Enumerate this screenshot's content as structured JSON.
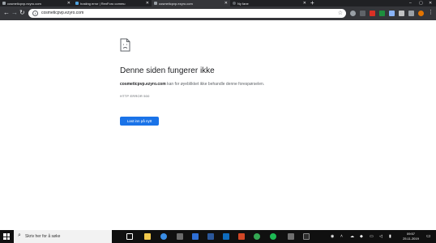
{
  "tabs": [
    {
      "title": "cosmeticpvp.ezyro.com",
      "fav_color": "#9aa0a6",
      "active": false
    },
    {
      "title": "hosting error | RenForo commu",
      "fav_color": "#4fa3e0",
      "active": false
    },
    {
      "title": "cosmeticpvp.ezyro.com",
      "fav_color": "#9aa0a6",
      "active": true
    },
    {
      "title": "Ny fane",
      "fav_color": "#5f6368",
      "active": false
    }
  ],
  "new_tab_label": "+",
  "address": {
    "url": "cosmeticpvp.ezyro.com"
  },
  "error": {
    "title": "Denne siden fungerer ikke",
    "host": "cosmeticpvp.ezyro.com",
    "message": " kan for øyeblikket ikke behandle denne forespørselen.",
    "code": "HTTP ERROR 500",
    "reload_label": "Last inn på nytt"
  },
  "taskbar": {
    "search_placeholder": "Skriv her for å søke",
    "time": "09:57",
    "date": "25.11.2019",
    "icons": [
      {
        "name": "task-view-icon",
        "color": "#ffffff"
      },
      {
        "name": "file-explorer-icon",
        "color": "#f2c94c"
      },
      {
        "name": "edge-icon",
        "color": "#3a8ee6"
      },
      {
        "name": "store-icon",
        "color": "#6b6b6b"
      },
      {
        "name": "mail-icon",
        "color": "#2f6fd6"
      },
      {
        "name": "word-icon",
        "color": "#2b579a"
      },
      {
        "name": "outlook-icon",
        "color": "#0f6cbd"
      },
      {
        "name": "powerpoint-icon",
        "color": "#d24726"
      },
      {
        "name": "chrome-icon",
        "color": "#34a853"
      },
      {
        "name": "spotify-icon",
        "color": "#1db954"
      },
      {
        "name": "game-icon",
        "color": "#6e6e6e"
      },
      {
        "name": "terminal-icon",
        "color": "#2d2d2d"
      }
    ]
  },
  "colors": {
    "accent": "#1a73e8",
    "chrome_dark": "#35363a"
  }
}
